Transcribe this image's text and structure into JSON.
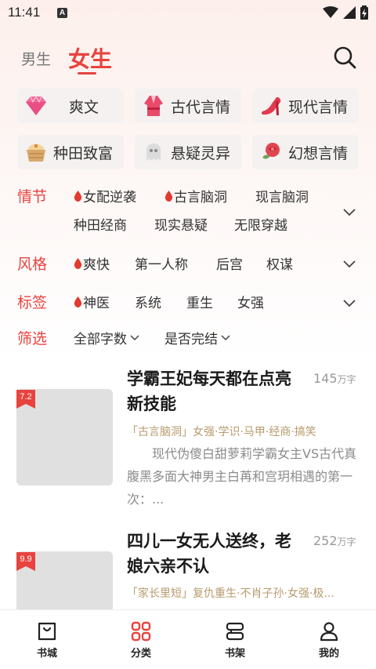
{
  "status_bar": {
    "time": "11:41",
    "notif_letter": "A"
  },
  "header": {
    "tabs": [
      {
        "label": "男生",
        "active": false
      },
      {
        "label": "女生",
        "active": true
      }
    ],
    "accent_color": "#e8433e"
  },
  "categories": [
    {
      "label": "爽文",
      "icon": "diamond-icon"
    },
    {
      "label": "古代言情",
      "icon": "robe-icon"
    },
    {
      "label": "现代言情",
      "icon": "high-heel-icon"
    },
    {
      "label": "种田致富",
      "icon": "grain-basket-icon"
    },
    {
      "label": "悬疑灵异",
      "icon": "ghost-icon"
    },
    {
      "label": "幻想言情",
      "icon": "rose-icon"
    }
  ],
  "filters": {
    "genre": {
      "title": "情节",
      "items": [
        {
          "label": "女配逆袭",
          "hot": true
        },
        {
          "label": "古言脑洞",
          "hot": true
        },
        {
          "label": "现言脑洞",
          "hot": false
        },
        {
          "label": "种田经商",
          "hot": false
        },
        {
          "label": "现实悬疑",
          "hot": false
        },
        {
          "label": "无限穿越",
          "hot": false
        }
      ]
    },
    "style": {
      "title": "风格",
      "items": [
        {
          "label": "爽快",
          "hot": true
        },
        {
          "label": "第一人称",
          "hot": false
        },
        {
          "label": "后宫",
          "hot": false
        },
        {
          "label": "权谋",
          "hot": false
        }
      ]
    },
    "tags": {
      "title": "标签",
      "items": [
        {
          "label": "神医",
          "hot": true
        },
        {
          "label": "系统",
          "hot": false
        },
        {
          "label": "重生",
          "hot": false
        },
        {
          "label": "女强",
          "hot": false
        }
      ]
    },
    "sort": {
      "title": "筛选",
      "items": [
        {
          "label": "全部字数"
        },
        {
          "label": "是否完结"
        }
      ]
    }
  },
  "books": [
    {
      "title": "学霸王妃每天都在点亮新技能",
      "score": "7.2",
      "word_count": "145",
      "word_unit": "万字",
      "tags": "「古言脑洞」女强·学识·马甲·经商·搞笑",
      "desc": "现代伪傻白甜萝莉学霸女主VS古代真腹黑多面大神男主白苒和宫玥相遇的第一次：..."
    },
    {
      "title": "四儿一女无人送终，老娘六亲不认",
      "score": "9.9",
      "word_count": "252",
      "word_unit": "万字",
      "tags": "「家长里短」复仇重生·不肖子孙·女强·极..."
    }
  ],
  "bottom_nav": [
    {
      "label": "书城",
      "icon": "bookstore-icon",
      "active": false
    },
    {
      "label": "分类",
      "icon": "category-grid-icon",
      "active": true
    },
    {
      "label": "书架",
      "icon": "bookshelf-icon",
      "active": false
    },
    {
      "label": "我的",
      "icon": "profile-icon",
      "active": false
    }
  ]
}
